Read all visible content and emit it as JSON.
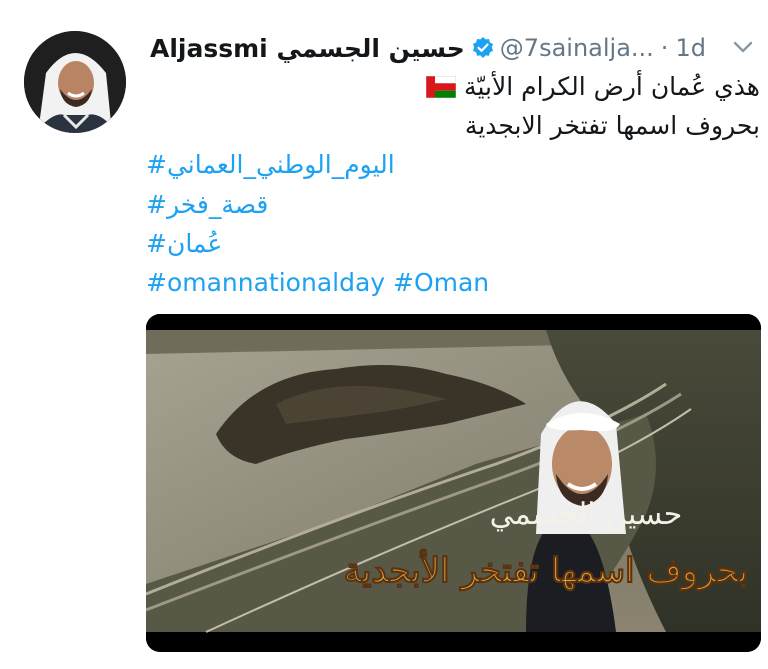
{
  "tweet": {
    "name": "Aljassmi حسين الجسمي",
    "handle": "@7sainalja...",
    "separator": "·",
    "time": "1d",
    "line1": "هذي عُمان أرض الكرام الأبيّة",
    "line2": "بحروف اسمها تفتخر الابجدية",
    "hashtags": [
      "#اليوم_الوطني_العماني",
      "#قصة_فخر",
      "#عُمان",
      "#omannationalday #Oman"
    ]
  },
  "media": {
    "overlay_name": "حسين الجسمي",
    "overlay_title": "بحروف اسمها تفتخر الأبجدية"
  },
  "colors": {
    "link": "#1da1f2",
    "verified": "#1da1f2",
    "muted": "#657786",
    "text": "#14171a"
  },
  "icons": {
    "verified": "verified-badge-icon",
    "flag": "oman-flag-icon",
    "menu": "chevron-down-icon"
  }
}
